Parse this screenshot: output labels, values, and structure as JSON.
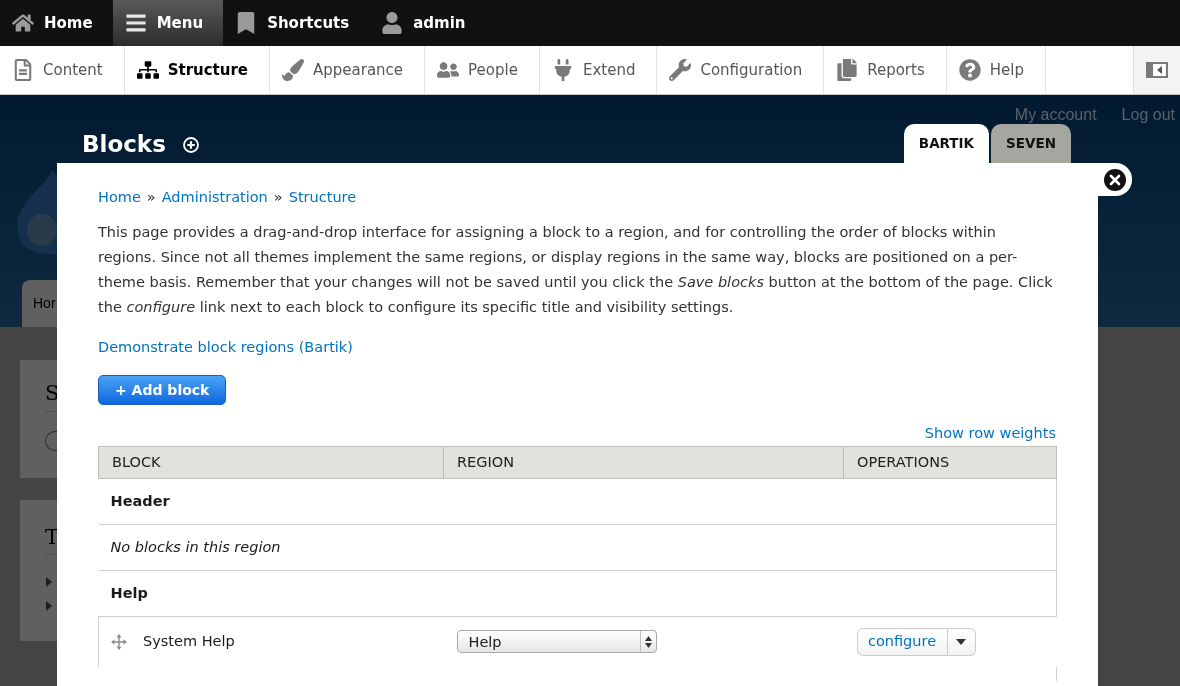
{
  "toolbar": {
    "items": [
      {
        "label": "Home",
        "selected": false
      },
      {
        "label": "Menu",
        "selected": true
      },
      {
        "label": "Shortcuts",
        "selected": false
      },
      {
        "label": "admin",
        "selected": false
      }
    ]
  },
  "admin_menu": {
    "items": [
      {
        "label": "Content",
        "selected": false
      },
      {
        "label": "Structure",
        "selected": true
      },
      {
        "label": "Appearance",
        "selected": false
      },
      {
        "label": "People",
        "selected": false
      },
      {
        "label": "Extend",
        "selected": false
      },
      {
        "label": "Configuration",
        "selected": false
      },
      {
        "label": "Reports",
        "selected": false
      },
      {
        "label": "Help",
        "selected": false
      }
    ]
  },
  "page_header": {
    "title": "Blocks",
    "secondary_links": [
      "My account",
      "Log out"
    ],
    "theme_tabs": [
      {
        "label": "BARTIK",
        "selected": true
      },
      {
        "label": "SEVEN",
        "selected": false
      }
    ]
  },
  "background_page": {
    "tab": "Hor",
    "sidebar_headings": [
      "S",
      "T"
    ]
  },
  "dialog": {
    "breadcrumb": {
      "links": [
        "Home",
        "Administration",
        "Structure"
      ],
      "separators": [
        "»",
        "»"
      ]
    },
    "description": "This page provides a drag-and-drop interface for assigning a block to a region, and for controlling the order of blocks within regions. Since not all themes implement the same regions, or display regions in the same way, blocks are positioned on a per-theme basis. Remember that your changes will not be saved until you click the *Save blocks* button at the bottom of the page. Click the *configure* link next to each block to configure its specific title and visibility settings.",
    "demo_link": "Demonstrate block regions (Bartik)",
    "add_button": "+ Add block",
    "row_weights_link": "Show row weights",
    "table": {
      "columns": [
        "BLOCK",
        "REGION",
        "OPERATIONS"
      ],
      "rows": [
        {
          "kind": "region",
          "title": "Header"
        },
        {
          "kind": "empty",
          "message": "No blocks in this region"
        },
        {
          "kind": "region",
          "title": "Help"
        },
        {
          "kind": "block",
          "name": "System Help",
          "region": "Help",
          "operation": "configure"
        }
      ]
    }
  }
}
